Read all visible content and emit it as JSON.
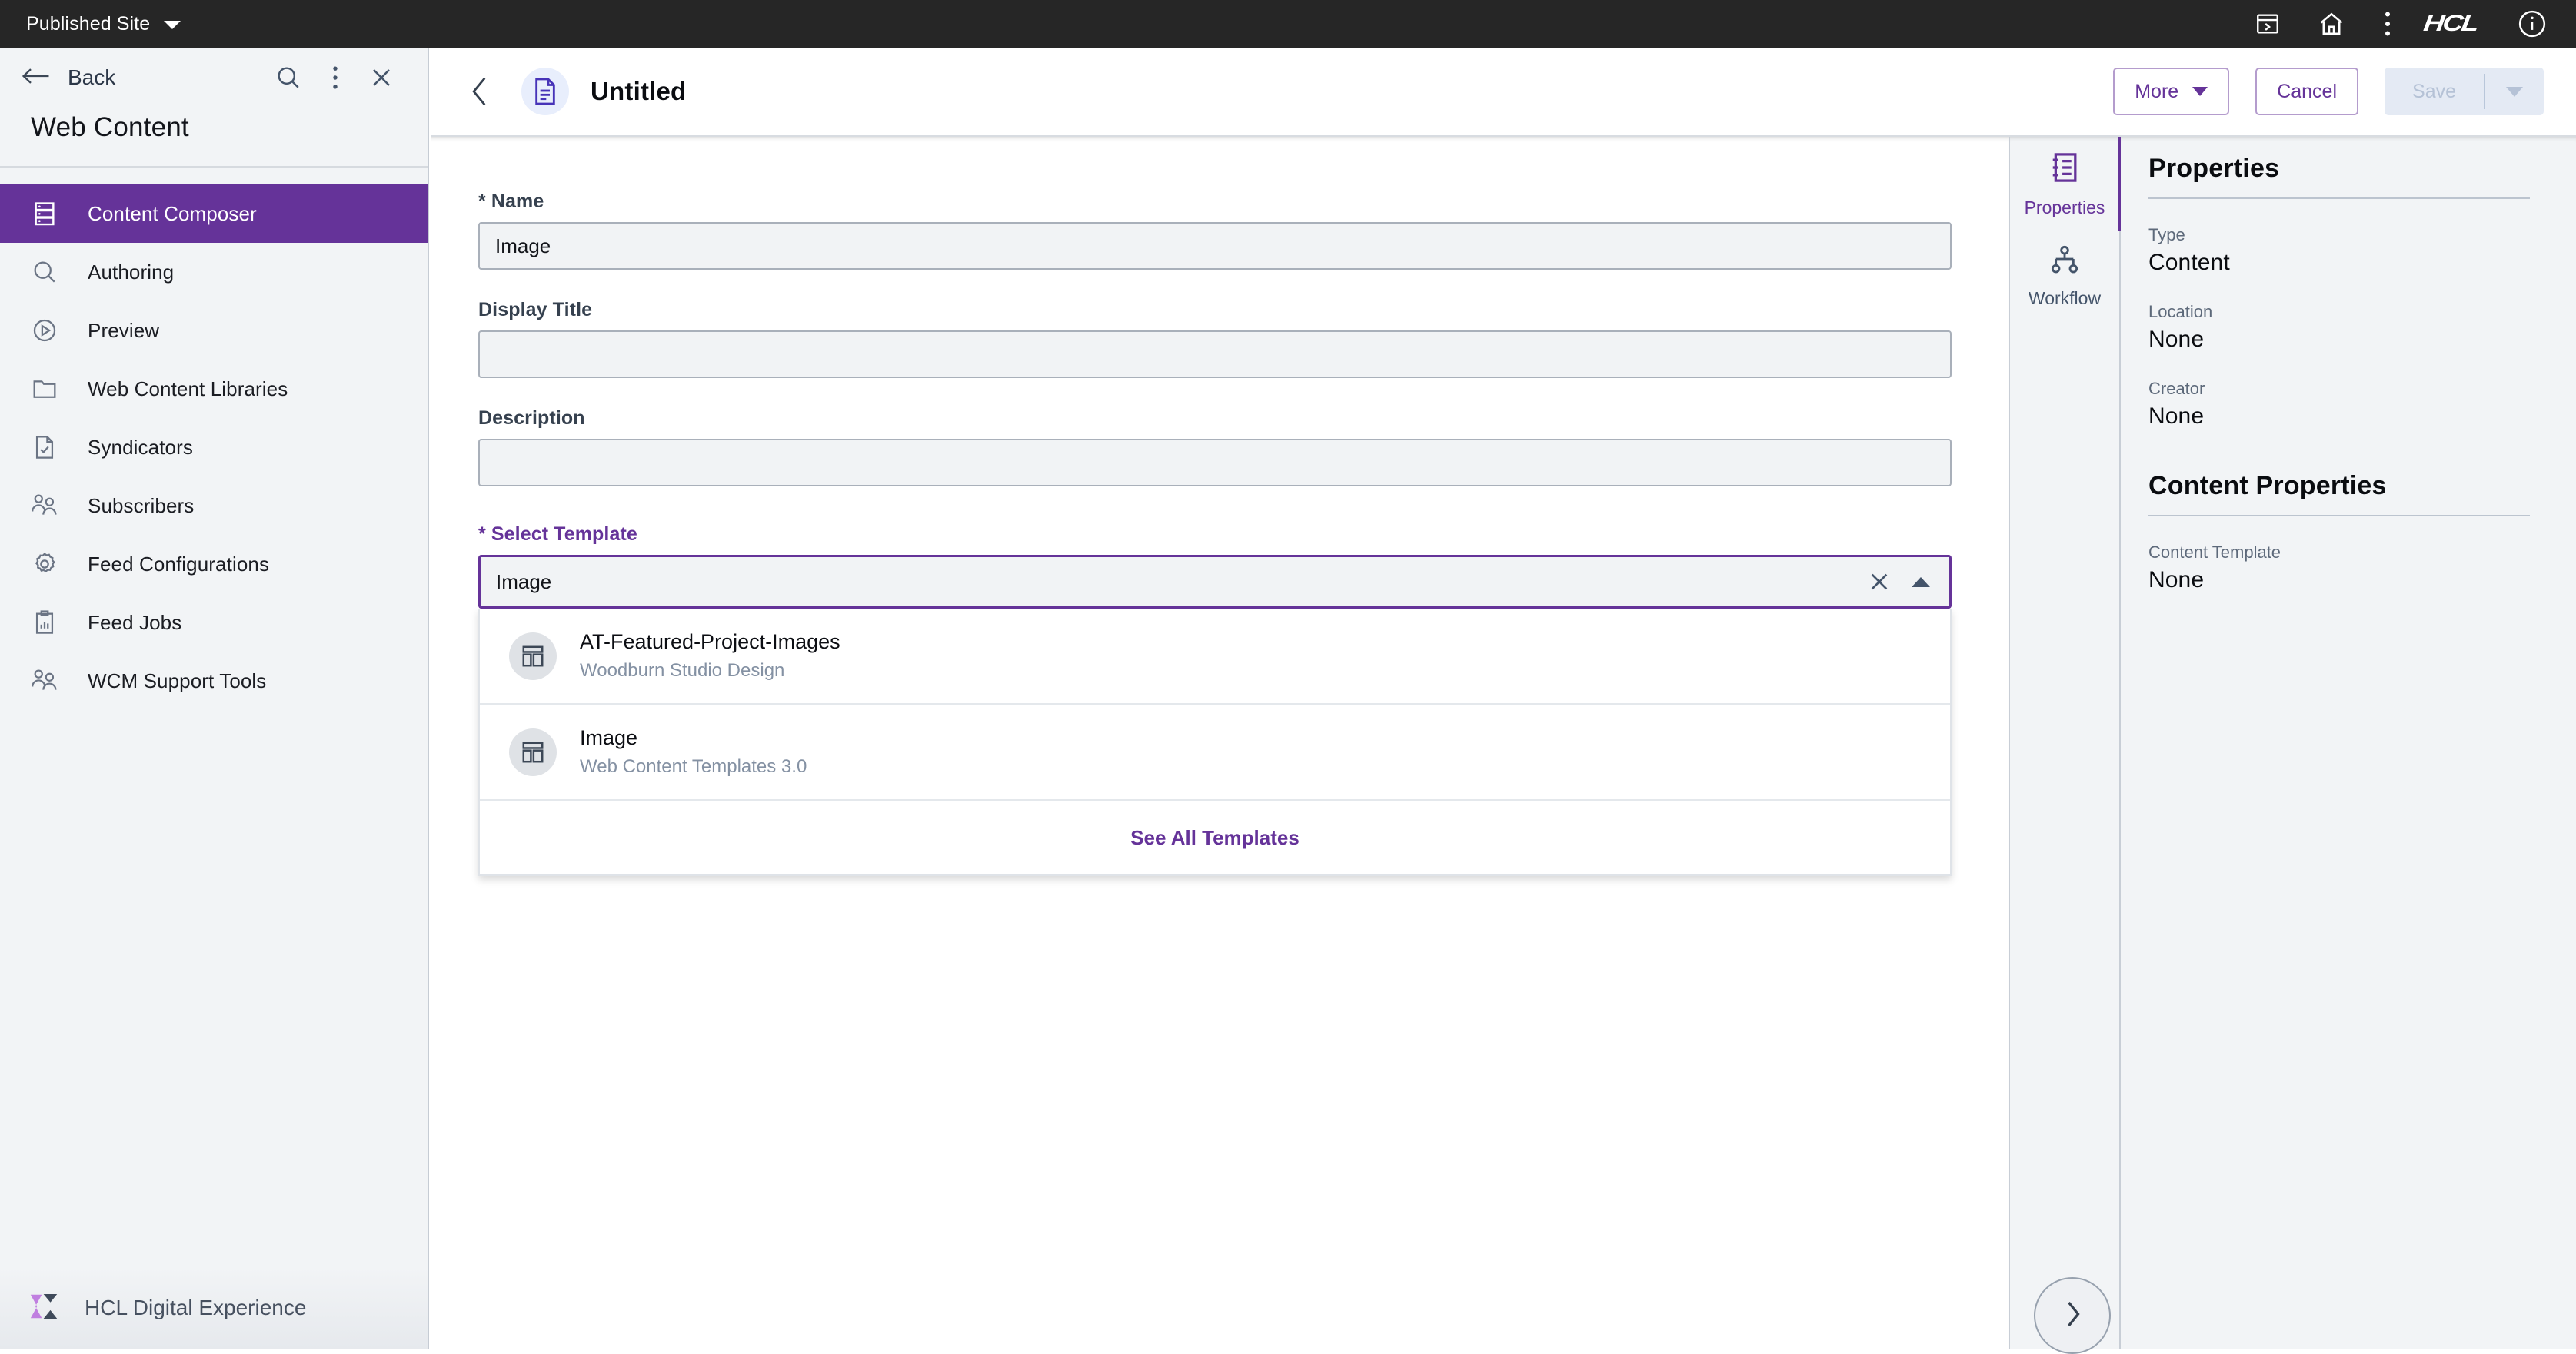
{
  "topbar": {
    "site_selector_label": "Published Site",
    "icons": [
      "panel-chevron-icon",
      "home-icon",
      "overflow-menu-icon",
      "info-icon"
    ],
    "brand": "HCL"
  },
  "sidebar": {
    "back_label": "Back",
    "heading": "Web Content",
    "header_icons": [
      "search-icon",
      "overflow-menu-icon",
      "close-icon"
    ],
    "items": [
      {
        "label": "Content Composer",
        "icon": "server-rack-icon",
        "active": true
      },
      {
        "label": "Authoring",
        "icon": "search-icon",
        "active": false
      },
      {
        "label": "Preview",
        "icon": "play-circle-icon",
        "active": false
      },
      {
        "label": "Web Content Libraries",
        "icon": "folder-icon",
        "active": false
      },
      {
        "label": "Syndicators",
        "icon": "document-check-icon",
        "active": false
      },
      {
        "label": "Subscribers",
        "icon": "users-icon",
        "active": false
      },
      {
        "label": "Feed Configurations",
        "icon": "gear-icon",
        "active": false
      },
      {
        "label": "Feed Jobs",
        "icon": "clipboard-chart-icon",
        "active": false
      },
      {
        "label": "WCM Support Tools",
        "icon": "users-icon",
        "active": false
      }
    ],
    "footer_label": "HCL Digital Experience",
    "active_color": "#653399"
  },
  "main_header": {
    "document_title": "Untitled",
    "more_label": "More",
    "cancel_label": "Cancel",
    "save_label": "Save"
  },
  "form": {
    "fields": [
      {
        "label": "Name",
        "required": true,
        "value": "Image",
        "placeholder": ""
      },
      {
        "label": "Display Title",
        "required": false,
        "value": "",
        "placeholder": ""
      },
      {
        "label": "Description",
        "required": false,
        "value": "",
        "placeholder": ""
      }
    ],
    "template_field": {
      "label": "Select Template",
      "required": true,
      "value": "Image",
      "placeholder": "",
      "focused": true,
      "expanded": true
    }
  },
  "dropdown": {
    "options": [
      {
        "title": "AT-Featured-Project-Images",
        "subtitle": "Woodburn Studio Design",
        "icon": "layout-template-icon"
      },
      {
        "title": "Image",
        "subtitle": "Web Content Templates 3.0",
        "icon": "layout-template-icon"
      }
    ],
    "footer_link": "See All Templates"
  },
  "tab_rail": {
    "tabs": [
      {
        "label": "Properties",
        "icon": "properties-list-icon",
        "active": true
      },
      {
        "label": "Workflow",
        "icon": "workflow-tree-icon",
        "active": false
      }
    ]
  },
  "properties_panel": {
    "section_title": "Properties",
    "rows": [
      {
        "key": "Type",
        "value": "Content"
      },
      {
        "key": "Location",
        "value": "None"
      },
      {
        "key": "Creator",
        "value": "None"
      }
    ],
    "second_section_title": "Content Properties",
    "second_rows": [
      {
        "key": "Content Template",
        "value": "None"
      }
    ]
  },
  "fab": {
    "icon": "chevron-right-icon"
  }
}
